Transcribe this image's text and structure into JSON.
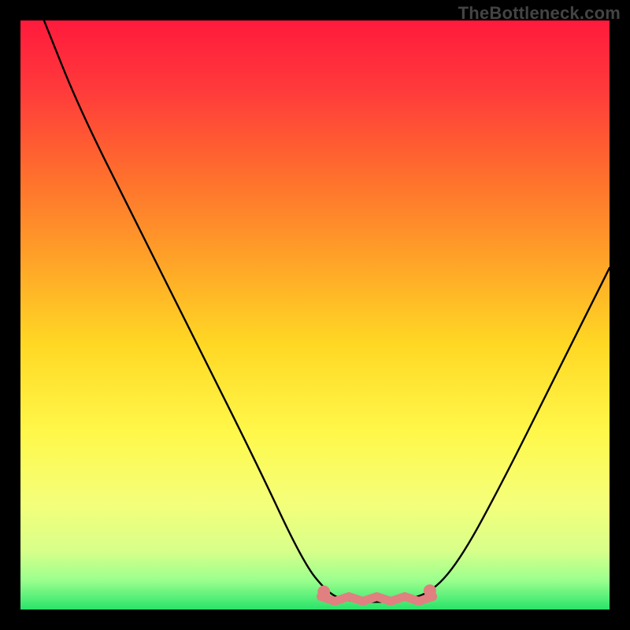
{
  "watermark": "TheBottleneck.com",
  "chart_data": {
    "type": "line",
    "title": "",
    "xlabel": "",
    "ylabel": "",
    "xlim": [
      0,
      100
    ],
    "ylim": [
      0,
      100
    ],
    "background_gradient_stops": [
      {
        "offset": 0.0,
        "color": "#ff1a3c"
      },
      {
        "offset": 0.12,
        "color": "#ff3b3b"
      },
      {
        "offset": 0.25,
        "color": "#ff6a2e"
      },
      {
        "offset": 0.4,
        "color": "#ffa028"
      },
      {
        "offset": 0.55,
        "color": "#ffd824"
      },
      {
        "offset": 0.7,
        "color": "#fff84a"
      },
      {
        "offset": 0.82,
        "color": "#f4ff7a"
      },
      {
        "offset": 0.9,
        "color": "#d8ff8a"
      },
      {
        "offset": 0.95,
        "color": "#9cff8e"
      },
      {
        "offset": 1.0,
        "color": "#29e36a"
      }
    ],
    "series": [
      {
        "name": "bottleneck-curve",
        "stroke": "#000000",
        "points": [
          {
            "x": 4,
            "y": 100
          },
          {
            "x": 10,
            "y": 85
          },
          {
            "x": 20,
            "y": 65
          },
          {
            "x": 30,
            "y": 45
          },
          {
            "x": 40,
            "y": 25
          },
          {
            "x": 48,
            "y": 8
          },
          {
            "x": 52,
            "y": 3
          },
          {
            "x": 55,
            "y": 1.5
          },
          {
            "x": 60,
            "y": 1.2
          },
          {
            "x": 65,
            "y": 1.5
          },
          {
            "x": 70,
            "y": 3
          },
          {
            "x": 75,
            "y": 9
          },
          {
            "x": 82,
            "y": 22
          },
          {
            "x": 90,
            "y": 38
          },
          {
            "x": 100,
            "y": 58
          }
        ]
      }
    ],
    "optimal_band": {
      "color": "#e08080",
      "x_start": 51,
      "x_end": 70,
      "y": 1.8,
      "endpoint_left": {
        "x": 51.5,
        "y": 3
      },
      "endpoint_right": {
        "x": 69.5,
        "y": 3.2
      }
    }
  }
}
